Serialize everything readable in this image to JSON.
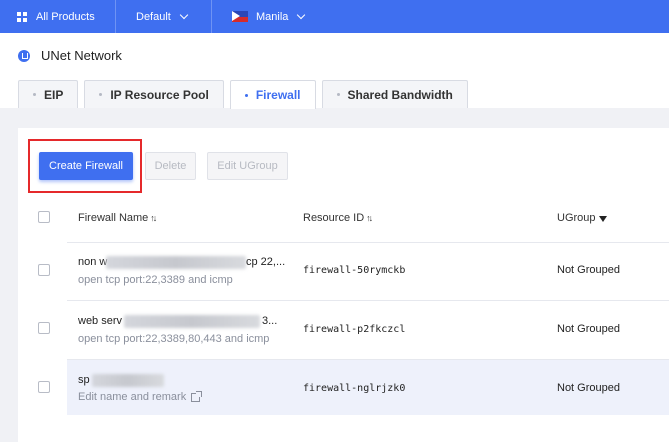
{
  "topbar": {
    "products_label": "All Products",
    "project_label": "Default",
    "region_label": "Manila"
  },
  "page": {
    "title": "UNet Network"
  },
  "tabs": [
    {
      "label": "EIP",
      "active": false
    },
    {
      "label": "IP Resource Pool",
      "active": false
    },
    {
      "label": "Firewall",
      "active": true
    },
    {
      "label": "Shared Bandwidth",
      "active": false
    }
  ],
  "toolbar": {
    "create_label": "Create Firewall",
    "delete_label": "Delete",
    "edit_ugroup_label": "Edit UGroup"
  },
  "table": {
    "columns": {
      "name": "Firewall Name",
      "resource_id": "Resource ID",
      "ugroup": "UGroup"
    },
    "rows": [
      {
        "name_start": "non w",
        "name_end": "cp 22,...",
        "remark": "open tcp port:22,3389 and icmp",
        "resource_id": "firewall-50rymckb",
        "ugroup": "Not Grouped"
      },
      {
        "name_start": "web serv",
        "name_end": "3...",
        "remark": "open tcp port:22,3389,80,443 and icmp",
        "resource_id": "firewall-p2fkczcl",
        "ugroup": "Not Grouped"
      },
      {
        "name_start": "sp",
        "name_end": "",
        "remark": "Edit name and remark",
        "resource_id": "firewall-nglrjzk0",
        "ugroup": "Not Grouped"
      }
    ]
  },
  "colors": {
    "primary": "#3f6ff0",
    "highlight_box": "#e5292b"
  }
}
